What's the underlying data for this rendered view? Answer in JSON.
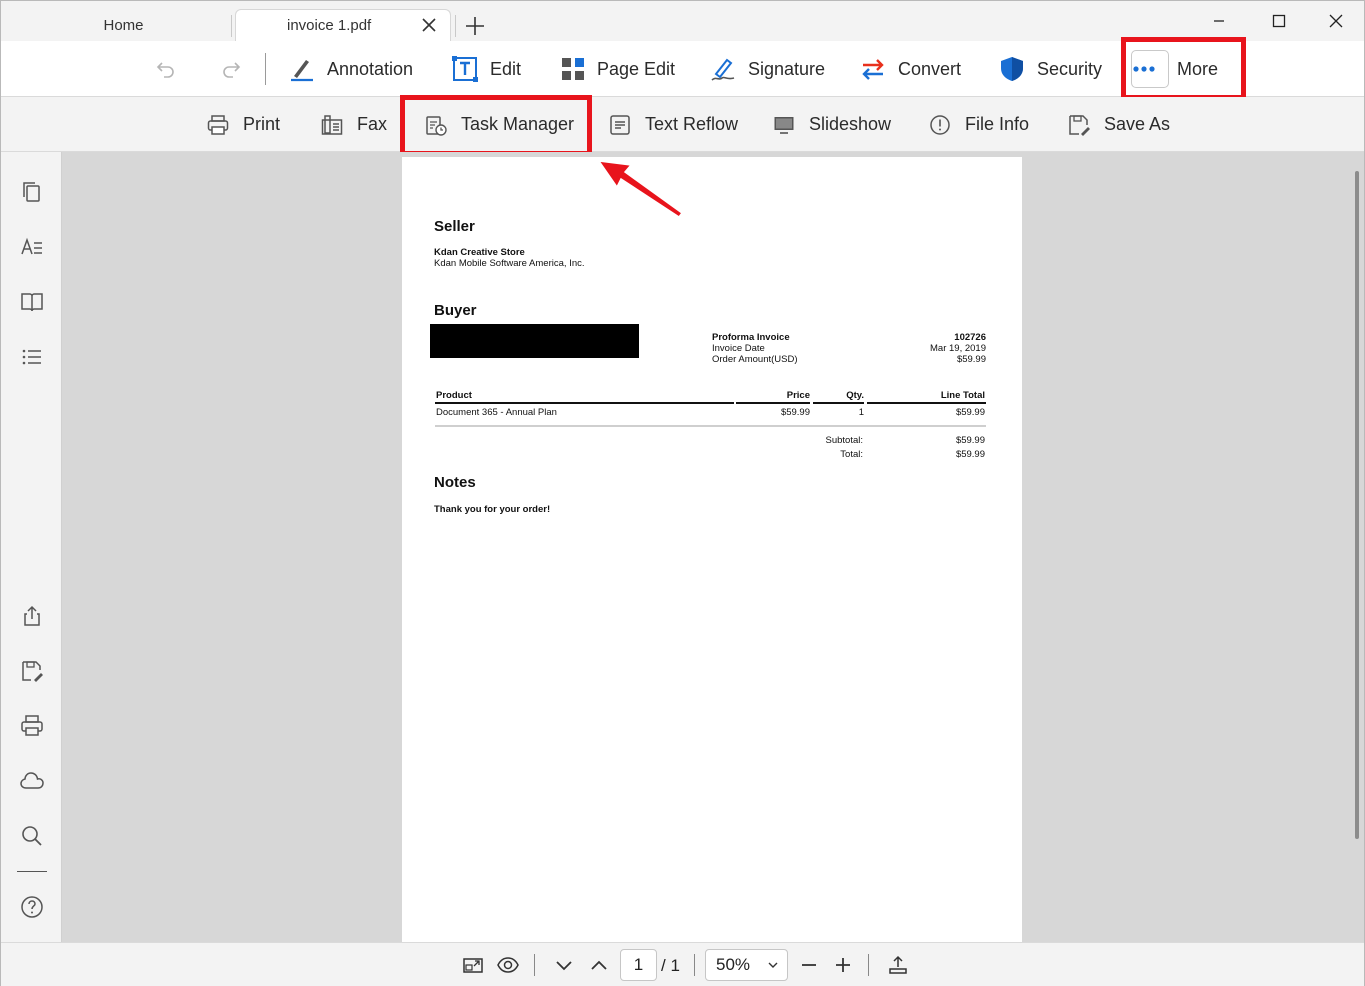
{
  "tabs": {
    "home_label": "Home",
    "active_label": "invoice 1.pdf"
  },
  "toolbar": {
    "annotation": "Annotation",
    "edit": "Edit",
    "page_edit": "Page Edit",
    "signature": "Signature",
    "convert": "Convert",
    "security": "Security",
    "more": "More"
  },
  "subtoolbar": {
    "print": "Print",
    "fax": "Fax",
    "task_manager": "Task Manager",
    "text_reflow": "Text Reflow",
    "slideshow": "Slideshow",
    "file_info": "File Info",
    "save_as": "Save As"
  },
  "document": {
    "seller_heading": "Seller",
    "seller_name": "Kdan Creative Store",
    "seller_company": "Kdan Mobile Software America, Inc.",
    "buyer_heading": "Buyer",
    "invoice_label": "Proforma Invoice",
    "invoice_number": "102726",
    "invoice_date_label": "Invoice Date",
    "invoice_date": "Mar 19, 2019",
    "order_amount_label": "Order Amount(USD)",
    "order_amount": "$59.99",
    "table": {
      "headers": [
        "Product",
        "Price",
        "Qty.",
        "Line Total"
      ],
      "rows": [
        [
          "Document 365 - Annual Plan",
          "$59.99",
          "1",
          "$59.99"
        ]
      ]
    },
    "subtotal_label": "Subtotal:",
    "subtotal": "$59.99",
    "total_label": "Total:",
    "total": "$59.99",
    "notes_heading": "Notes",
    "notes_text": "Thank you for your order!"
  },
  "bottombar": {
    "page_current": "1",
    "page_total": "/ 1",
    "zoom": "50%"
  },
  "colors": {
    "highlight": "#e8141c",
    "accent_blue": "#1a6fd4"
  }
}
